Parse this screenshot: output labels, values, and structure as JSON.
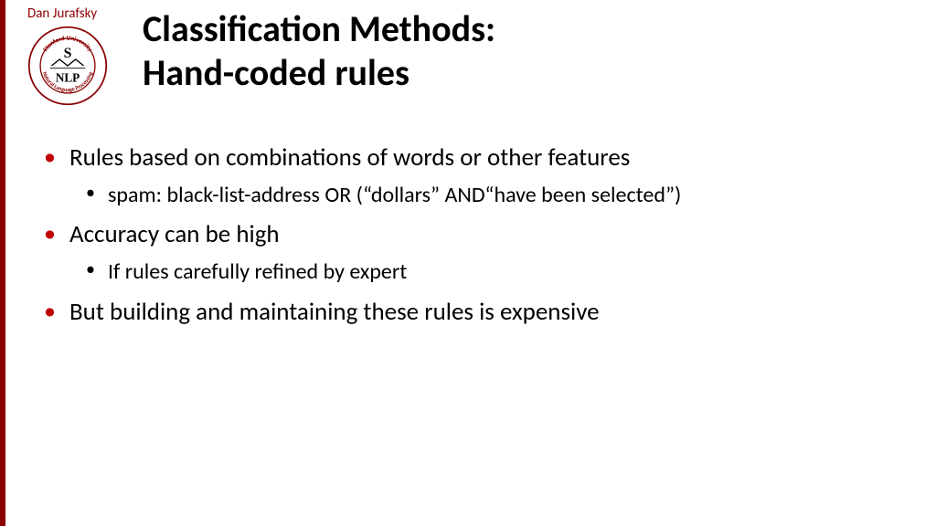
{
  "author": "Dan Jurafsky",
  "logo": {
    "top_text": "S",
    "bottom_text": "NLP",
    "outer_text_top": "Stanford University",
    "outer_text_bottom": "Natural Language Processing"
  },
  "title_line1": "Classification Methods:",
  "title_line2": "Hand-coded rules",
  "bullets": [
    {
      "text": "Rules based on combinations of words or other features",
      "sub": [
        "spam: black-list-address OR (“dollars” AND“have been selected”)"
      ]
    },
    {
      "text": "Accuracy can be high",
      "sub": [
        "If rules carefully refined by expert"
      ]
    },
    {
      "text": "But building and maintaining these rules is expensive",
      "sub": []
    }
  ]
}
